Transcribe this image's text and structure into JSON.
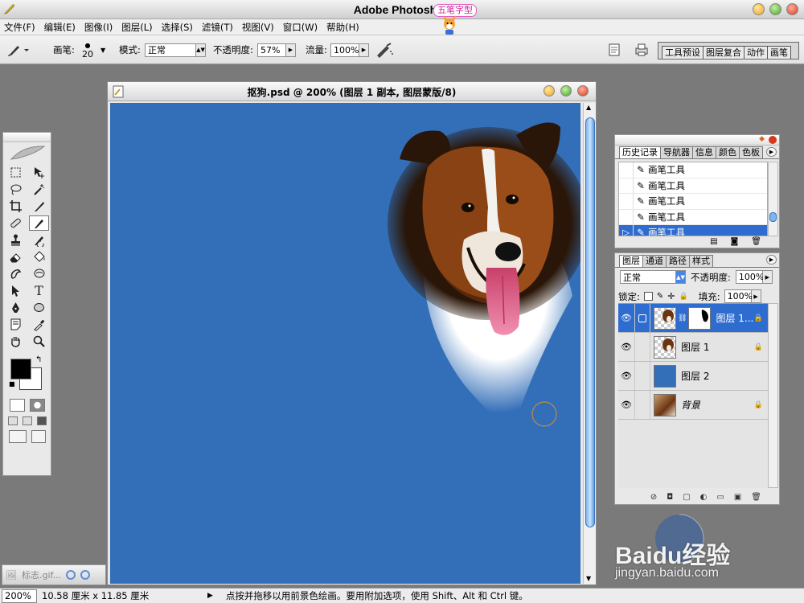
{
  "app": {
    "title": "Adobe Photoshop",
    "badge": "五笔字型"
  },
  "menu": [
    "文件(F)",
    "编辑(E)",
    "图像(I)",
    "图层(L)",
    "选择(S)",
    "滤镜(T)",
    "视图(V)",
    "窗口(W)",
    "帮助(H)"
  ],
  "options": {
    "brush_label": "画笔:",
    "brush_size": "20",
    "mode_label": "模式:",
    "mode_value": "正常",
    "opacity_label": "不透明度:",
    "opacity_value": "57%",
    "flow_label": "流量:",
    "flow_value": "100%"
  },
  "palette_well": {
    "tabs": [
      "工具预设",
      "图层复合",
      "动作",
      "画笔"
    ]
  },
  "document": {
    "title": "抠狗.psd @ 200% (图层 1 副本, 图层蒙版/8)"
  },
  "history": {
    "tabs": [
      "历史记录",
      "导航器",
      "信息",
      "颜色",
      "色板"
    ],
    "items": [
      "画笔工具",
      "画笔工具",
      "画笔工具",
      "画笔工具",
      "画笔工具"
    ],
    "selected_index": 4
  },
  "layers": {
    "tabs": [
      "图层",
      "通道",
      "路径",
      "样式"
    ],
    "blend_mode": "正常",
    "opacity_label": "不透明度:",
    "opacity_value": "100%",
    "lock_label": "锁定:",
    "fill_label": "填充:",
    "fill_value": "100%",
    "items": [
      {
        "name": "图层 1...",
        "selected": true,
        "locked": true
      },
      {
        "name": "图层 1",
        "selected": false,
        "locked": true
      },
      {
        "name": "图层 2",
        "selected": false,
        "locked": false
      },
      {
        "name": "背景",
        "selected": false,
        "locked": true
      }
    ]
  },
  "minimized_doc": {
    "title": "标志.gif..."
  },
  "status": {
    "zoom": "200%",
    "doc_size": "10.58 厘米 x 11.85 厘米",
    "message": "点按并拖移以用前景色绘画。要用附加选项，使用 Shift、Alt 和 Ctrl 键。"
  },
  "colors": {
    "canvas_blue": "#336fb8",
    "selection_blue": "#2f6ccf",
    "foreground": "#000000",
    "background": "#ffffff"
  },
  "watermark": {
    "brand": "Baidu经验",
    "url": "jingyan.baidu.com"
  }
}
